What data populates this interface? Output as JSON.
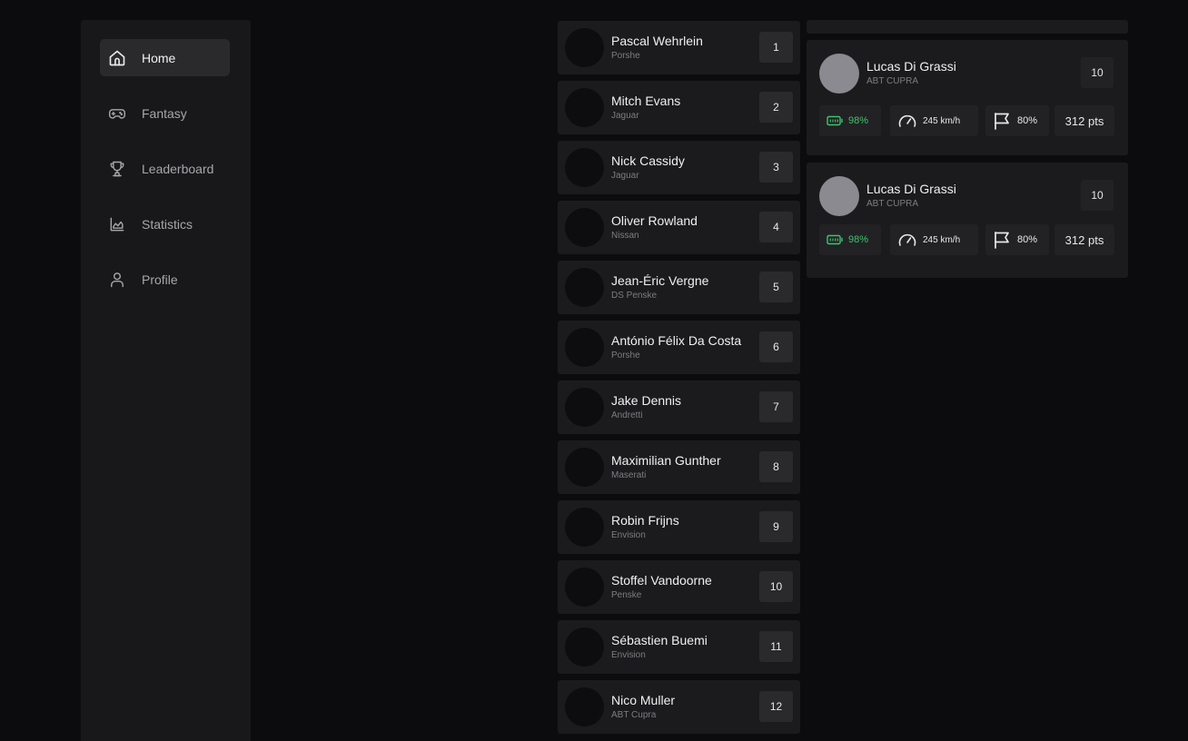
{
  "sidebar": {
    "items": [
      {
        "label": "Home",
        "icon": "home-icon",
        "active": true
      },
      {
        "label": "Fantasy",
        "icon": "gamepad-icon",
        "active": false
      },
      {
        "label": "Leaderboard",
        "icon": "trophy-icon",
        "active": false
      },
      {
        "label": "Statistics",
        "icon": "chart-icon",
        "active": false
      },
      {
        "label": "Profile",
        "icon": "user-icon",
        "active": false
      }
    ]
  },
  "drivers": [
    {
      "name": "Pascal Wehrlein",
      "team": "Porshe",
      "position": "1"
    },
    {
      "name": "Mitch Evans",
      "team": "Jaguar",
      "position": "2"
    },
    {
      "name": "Nick Cassidy",
      "team": "Jaguar",
      "position": "3"
    },
    {
      "name": "Oliver Rowland",
      "team": "Nissan",
      "position": "4"
    },
    {
      "name": "Jean-Éric Vergne",
      "team": "DS Penske",
      "position": "5"
    },
    {
      "name": "António Félix Da Costa",
      "team": "Porshe",
      "position": "6"
    },
    {
      "name": "Jake Dennis",
      "team": "Andretti",
      "position": "7"
    },
    {
      "name": "Maximilian Gunther",
      "team": "Maserati",
      "position": "8"
    },
    {
      "name": "Robin Frijns",
      "team": "Envision",
      "position": "9"
    },
    {
      "name": "Stoffel Vandoorne",
      "team": "Penske",
      "position": "10"
    },
    {
      "name": "Sébastien Buemi",
      "team": "Envision",
      "position": "11"
    },
    {
      "name": "Nico Muller",
      "team": "ABT Cupra",
      "position": "12"
    }
  ],
  "details": [
    {
      "name": "Lucas Di Grassi",
      "team": "ABT CUPRA",
      "position": "10",
      "battery": "98%",
      "speed": "245 km/h",
      "flag": "80%",
      "points": "312 pts"
    },
    {
      "name": "Lucas Di Grassi",
      "team": "ABT CUPRA",
      "position": "10",
      "battery": "98%",
      "speed": "245 km/h",
      "flag": "80%",
      "points": "312 pts"
    }
  ],
  "colors": {
    "background": "#0c0c0e",
    "card": "#1b1b1d",
    "accent_green": "#3ec46d"
  }
}
